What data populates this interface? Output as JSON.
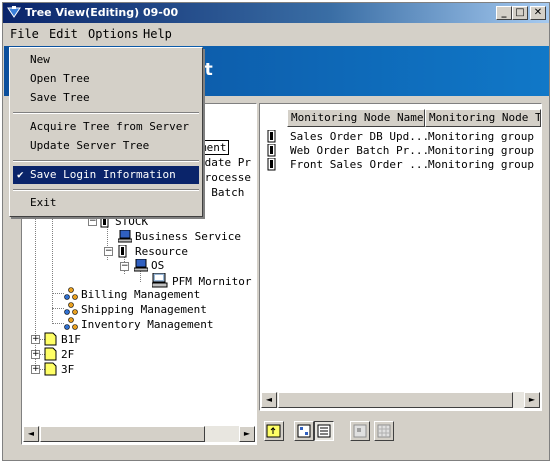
{
  "window": {
    "title": "Tree View(Editing) 09-00",
    "controls": {
      "minimize": "_",
      "maximize": "□",
      "close": "✕"
    }
  },
  "menubar": [
    "File",
    "Edit",
    "Options",
    "Help"
  ],
  "banner": {
    "partial_text": "ent"
  },
  "file_menu": {
    "items": [
      {
        "label": "New"
      },
      {
        "label": "Open Tree"
      },
      {
        "label": "Save Tree"
      },
      {
        "label": "Acquire Tree from Server"
      },
      {
        "label": "Update Server Tree"
      },
      {
        "label": "Save Login Information",
        "checked": true,
        "highlighted": true
      },
      {
        "label": "Exit"
      }
    ],
    "check_glyph": "✔"
  },
  "tree": {
    "partial_labels": [
      "ment",
      "pdate Pr",
      "Processe",
      "r Batch"
    ],
    "nodes": [
      {
        "label": "STOCK",
        "icon": "server-icon"
      },
      {
        "label": "Business Service",
        "icon": "monitor-icon"
      },
      {
        "label": "Resource",
        "icon": "server-icon"
      },
      {
        "label": "OS",
        "icon": "monitor-icon"
      },
      {
        "label": "PFM Mornitor",
        "icon": "pfm-monitor-icon"
      },
      {
        "label": "Billing Management",
        "icon": "group-icon"
      },
      {
        "label": "Shipping Management",
        "icon": "group-icon"
      },
      {
        "label": "Inventory Management",
        "icon": "group-icon"
      },
      {
        "label": "B1F",
        "icon": "folder-icon"
      },
      {
        "label": "2F",
        "icon": "folder-icon"
      },
      {
        "label": "3F",
        "icon": "folder-icon"
      }
    ],
    "expand_glyphs": {
      "expanded": "−",
      "collapsed": "+"
    }
  },
  "list": {
    "columns": [
      "Monitoring Node Name",
      "Monitoring Node T"
    ],
    "rows": [
      {
        "name": "Sales Order DB Upd...",
        "type": "Monitoring group"
      },
      {
        "name": "Web Order Batch Pr...",
        "type": "Monitoring group"
      },
      {
        "name": "Front Sales Order ...",
        "type": "Monitoring group"
      }
    ]
  },
  "scroll_glyphs": {
    "left": "◄",
    "right": "►"
  },
  "colors": {
    "banner": "#0b4f9c",
    "selection": "#0a246a",
    "folder": "#ffff66"
  }
}
